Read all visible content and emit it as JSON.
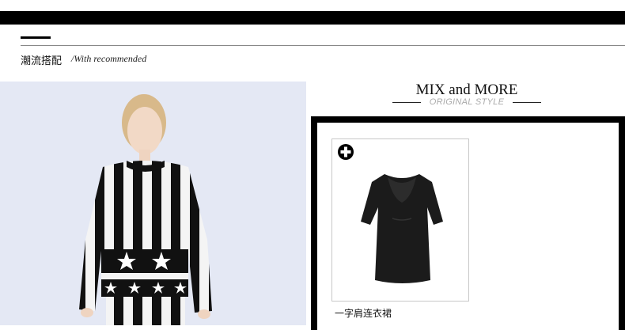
{
  "section": {
    "title_cn": "潮流搭配",
    "title_en": "/With recommended"
  },
  "mix": {
    "title": "MIX and MORE",
    "subtitle": "ORIGINAL STYLE"
  },
  "product": {
    "name": "一字肩连衣裙",
    "action_icon": "plus-circle-icon"
  },
  "colors": {
    "accent": "#000000",
    "photo_background": "#e4e8f4"
  }
}
